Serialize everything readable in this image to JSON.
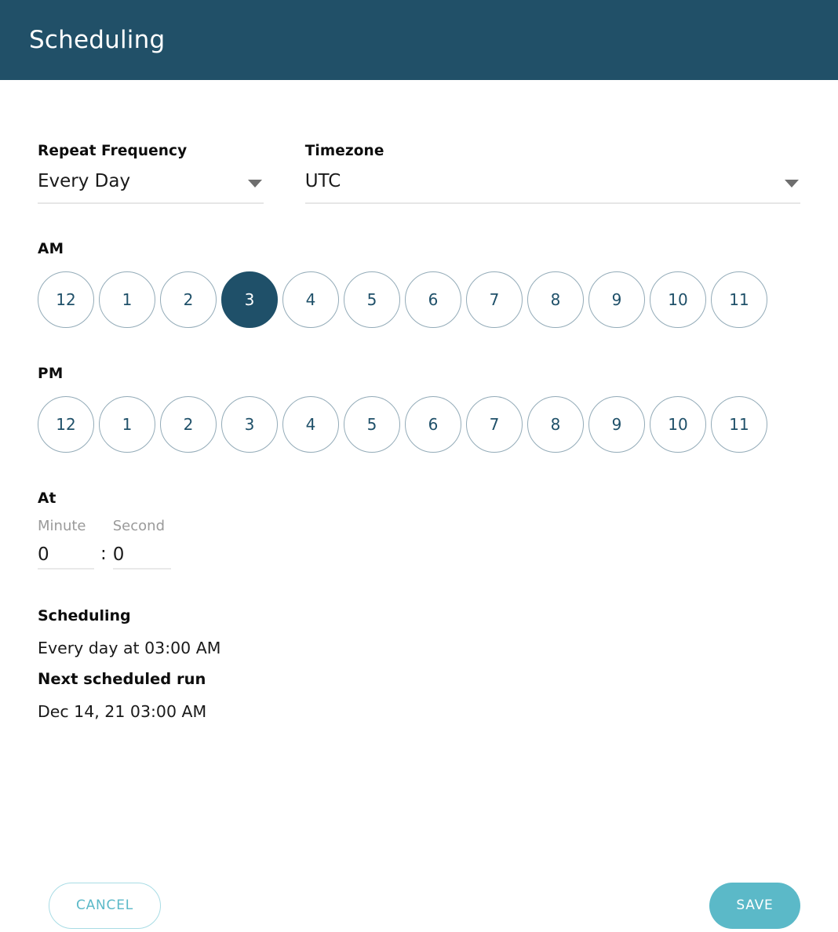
{
  "header": {
    "title": "Scheduling",
    "background": "#215068"
  },
  "form": {
    "repeat_frequency": {
      "label": "Repeat Frequency",
      "value": "Every Day",
      "caret_icon": "chevron-down-icon"
    },
    "timezone": {
      "label": "Timezone",
      "value": "UTC",
      "caret_icon": "chevron-down-icon"
    }
  },
  "am": {
    "label": "AM",
    "hours": [
      "12",
      "1",
      "2",
      "3",
      "4",
      "5",
      "6",
      "7",
      "8",
      "9",
      "10",
      "11"
    ],
    "selected": "3"
  },
  "pm": {
    "label": "PM",
    "hours": [
      "12",
      "1",
      "2",
      "3",
      "4",
      "5",
      "6",
      "7",
      "8",
      "9",
      "10",
      "11"
    ],
    "selected": null
  },
  "at": {
    "label": "At",
    "minute": {
      "caption": "Minute",
      "value": "0"
    },
    "separator": ":",
    "second": {
      "caption": "Second",
      "value": "0"
    }
  },
  "summary": {
    "title": "Scheduling",
    "description": "Every day at 03:00 AM",
    "next_run_label": "Next scheduled run",
    "next_run_value": "Dec 14, 21 03:00 AM"
  },
  "actions": {
    "cancel": "CANCEL",
    "save": "SAVE"
  },
  "colors": {
    "header": "#215068",
    "selected_hour": "#1f5069",
    "circle_border": "#93abb8",
    "accent_teal": "#5bb9c8",
    "cancel_border": "#a9dce5"
  }
}
